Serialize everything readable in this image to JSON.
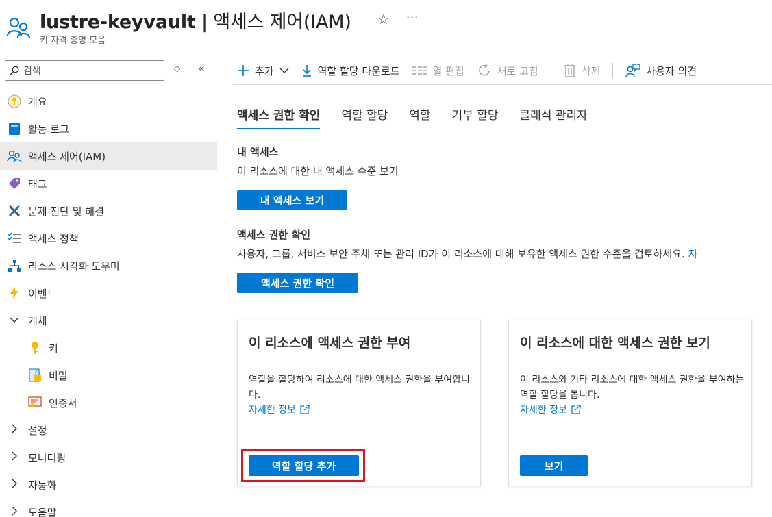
{
  "header": {
    "resource_name": "lustre-keyvault",
    "separator": " | ",
    "page_name": "액세스 제어(IAM)",
    "subtitle": "키 자격 증명 모음",
    "star": "☆",
    "more": "···"
  },
  "sidebar": {
    "search_placeholder": "검색",
    "items": [
      {
        "label": "개요",
        "icon": "key-circle-icon"
      },
      {
        "label": "활동 로그",
        "icon": "activity-log-icon"
      },
      {
        "label": "액세스 제어(IAM)",
        "icon": "people-icon",
        "selected": true
      },
      {
        "label": "태그",
        "icon": "tag-icon"
      },
      {
        "label": "문제 진단 및 해결",
        "icon": "wrench-icon"
      },
      {
        "label": "액세스 정책",
        "icon": "policy-list-icon"
      },
      {
        "label": "리소스 시각화 도우미",
        "icon": "hierarchy-icon"
      },
      {
        "label": "이벤트",
        "icon": "lightning-icon"
      },
      {
        "label": "개체",
        "expanded": true
      },
      {
        "label": "키",
        "icon": "key-icon",
        "sub": true
      },
      {
        "label": "비밀",
        "icon": "secret-icon",
        "sub": true
      },
      {
        "label": "인증서",
        "icon": "certificate-icon",
        "sub": true
      },
      {
        "label": "설정",
        "expanded": false
      },
      {
        "label": "모니터링",
        "expanded": false
      },
      {
        "label": "자동화",
        "expanded": false
      },
      {
        "label": "도움말",
        "expanded": false
      }
    ]
  },
  "toolbar": {
    "add": "추가",
    "download": "역할 할당 다운로드",
    "edit_columns": "열 편집",
    "refresh": "새로 고침",
    "delete": "삭제",
    "feedback": "사용자 의견"
  },
  "tabs": [
    "액세스 권한 확인",
    "역할 할당",
    "역할",
    "거부 할당",
    "클래식 관리자"
  ],
  "my_access": {
    "heading": "내 액세스",
    "desc": "이 리소스에 대한 내 액세스 수준 보기",
    "button": "내 액세스 보기"
  },
  "check_access": {
    "heading": "액세스 권한 확인",
    "desc": "사용자, 그룹, 서비스 보안 주체 또는 관리 ID가 이 리소스에 대해 보유한 액세스 권한 수준을 검토하세요.",
    "link_fragment": "자",
    "button": "액세스 권한 확인"
  },
  "cards": [
    {
      "title": "이 리소스에 액세스 권한 부여",
      "desc": "역할을 할당하여 리소스에 대한 액세스 권한을 부여합니다.",
      "link": "자세한 정보",
      "button": "역할 할당 추가"
    },
    {
      "title": "이 리소스에 대한 액세스 권한 보기",
      "desc": "이 리소스와 기타 리소스에 대한 액세스 권한을 부여하는 역할 할당을 봅니다.",
      "link": "자세한 정보",
      "button": "보기"
    }
  ],
  "colors": {
    "accent": "#0078d4",
    "highlight": "#e81123",
    "selected_bg": "#edebe9"
  }
}
